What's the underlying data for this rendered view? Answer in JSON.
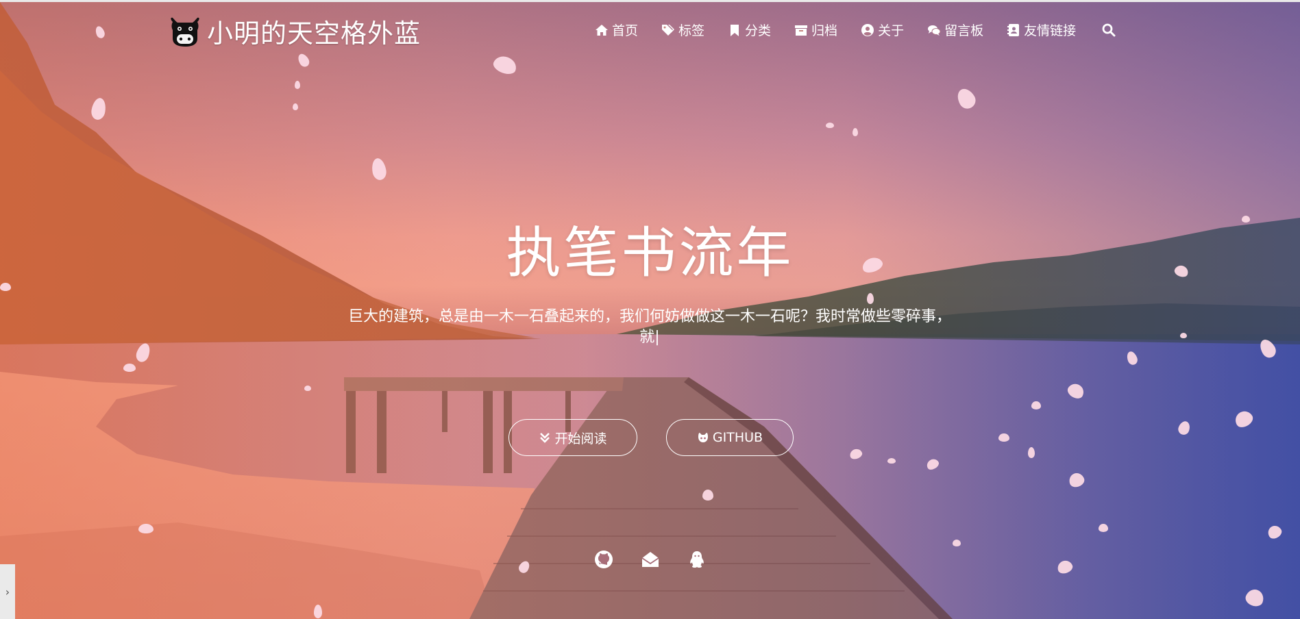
{
  "site": {
    "title": "小明的天空格外蓝",
    "logo_icon": "cow-head-icon"
  },
  "nav": {
    "items": [
      {
        "label": "首页",
        "icon": "home-icon"
      },
      {
        "label": "标签",
        "icon": "tags-icon"
      },
      {
        "label": "分类",
        "icon": "bookmark-icon"
      },
      {
        "label": "归档",
        "icon": "archive-icon"
      },
      {
        "label": "关于",
        "icon": "user-circle-icon"
      },
      {
        "label": "留言板",
        "icon": "comments-icon"
      },
      {
        "label": "友情链接",
        "icon": "address-book-icon"
      }
    ],
    "search_icon": "search-icon"
  },
  "hero": {
    "headline": "执笔书流年",
    "subtitle": "巨大的建筑，总是由一木一石叠起来的，我们何妨做做这一木一石呢？我时常做些零碎事，就|",
    "buttons": [
      {
        "label": "开始阅读",
        "icon": "chevrons-down-icon"
      },
      {
        "label": "GITHUB",
        "icon": "github-cat-icon"
      }
    ]
  },
  "social": [
    {
      "icon": "github-icon"
    },
    {
      "icon": "email-icon"
    },
    {
      "icon": "qq-icon"
    }
  ],
  "colors": {
    "text": "#ffffff",
    "petal": "#fbd9e4",
    "sky_top": "#9a6a86",
    "sky_mid": "#eda095",
    "lake_right": "#3c4d9c"
  },
  "side_toggle": {
    "label": "›"
  }
}
